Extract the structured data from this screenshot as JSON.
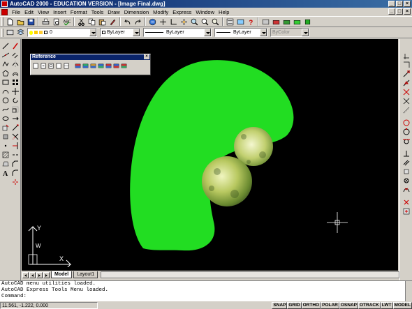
{
  "window": {
    "title": "AutoCAD 2000 - EDUCATION VERSION - [Image Final.dwg]",
    "controls": [
      "_",
      "□",
      "×"
    ]
  },
  "menu": [
    "File",
    "Edit",
    "View",
    "Insert",
    "Format",
    "Tools",
    "Draw",
    "Dimension",
    "Modify",
    "Express",
    "Window",
    "Help"
  ],
  "doc_controls": [
    "_",
    "□",
    "×"
  ],
  "properties": {
    "layer_value": "0",
    "color_value": "ByLayer",
    "linetype_value": "ByLayer",
    "lineweight_value": "ByLayer",
    "plotstyle_value": "ByColor"
  },
  "reference_toolbar": {
    "title": "Reference",
    "close": "×"
  },
  "tabs": [
    {
      "label": "Model",
      "active": true
    },
    {
      "label": "Layout1",
      "active": false
    }
  ],
  "ucs": {
    "y_label": "Y",
    "w_label": "W",
    "x_label": "X"
  },
  "command": {
    "history": [
      "AutoCAD menu utilities loaded.",
      "AutoCAD Express Tools Menu loaded."
    ],
    "prompt": "Command:"
  },
  "status": {
    "coordinates": "11.561, -1.222, 0.000",
    "buttons": [
      "SNAP",
      "GRID",
      "ORTHO",
      "POLAR",
      "OSNAP",
      "OTRACK",
      "LWT",
      "MODEL"
    ]
  },
  "colors": {
    "shape_fill": "#22dd22",
    "canvas_bg": "#000000",
    "title_bar": "#0a246a"
  }
}
